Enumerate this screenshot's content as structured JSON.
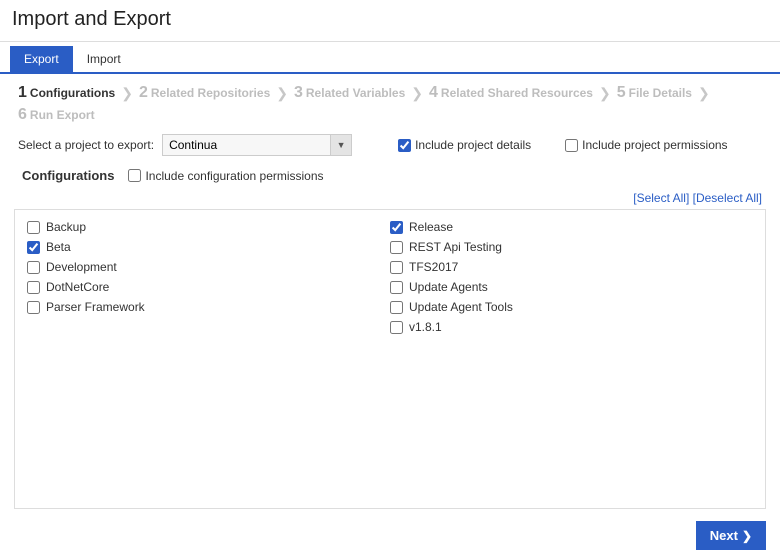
{
  "title": "Import and Export",
  "tabs": {
    "export": "Export",
    "import": "Import"
  },
  "wizard": [
    {
      "num": "1",
      "label": "Configurations",
      "active": true
    },
    {
      "num": "2",
      "label": "Related Repositories",
      "active": false
    },
    {
      "num": "3",
      "label": "Related Variables",
      "active": false
    },
    {
      "num": "4",
      "label": "Related Shared Resources",
      "active": false
    },
    {
      "num": "5",
      "label": "File Details",
      "active": false
    },
    {
      "num": "6",
      "label": "Run Export",
      "active": false
    }
  ],
  "project_select": {
    "label": "Select a project to export:",
    "value": "Continua"
  },
  "options": {
    "include_details": {
      "label": "Include project details",
      "checked": true
    },
    "include_permissions": {
      "label": "Include project permissions",
      "checked": false
    },
    "include_config_permissions": {
      "label": "Include configuration permissions",
      "checked": false
    }
  },
  "configs_header": "Configurations",
  "actions": {
    "select_all": "[Select All]",
    "deselect_all": "[Deselect All]"
  },
  "configs_left": [
    {
      "label": "Backup",
      "checked": false
    },
    {
      "label": "Beta",
      "checked": true
    },
    {
      "label": "Development",
      "checked": false
    },
    {
      "label": "DotNetCore",
      "checked": false
    },
    {
      "label": "Parser Framework",
      "checked": false
    }
  ],
  "configs_right": [
    {
      "label": "Release",
      "checked": true
    },
    {
      "label": "REST Api Testing",
      "checked": false
    },
    {
      "label": "TFS2017",
      "checked": false
    },
    {
      "label": "Update Agents",
      "checked": false
    },
    {
      "label": "Update Agent Tools",
      "checked": false
    },
    {
      "label": "v1.8.1",
      "checked": false
    }
  ],
  "next_button": "Next"
}
